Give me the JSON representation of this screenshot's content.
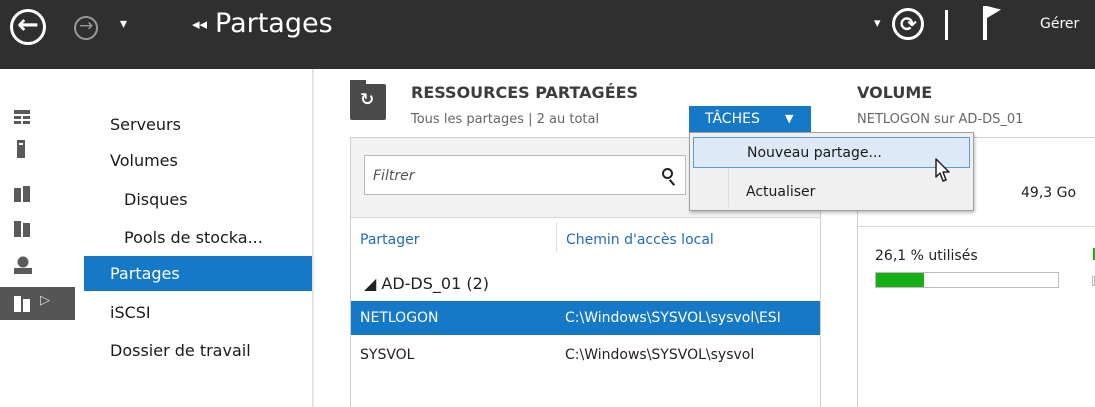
{
  "topbar": {
    "title": "Partages",
    "manage_label": "Gérer",
    "back_arrow": "←",
    "forward_arrow": "→",
    "nav_dropdown": "▾",
    "breadcrumb_chevron": "◂◂",
    "refresh_dropdown": "▾",
    "refresh_glyph": "⟳"
  },
  "icon_rail": {
    "items": [
      "dashboard-icon",
      "local-server-icon",
      "all-servers-icon",
      "file-services-icon",
      "users-icon",
      "file-storage-icon"
    ],
    "expand_glyph": "▷"
  },
  "nav": {
    "items": [
      {
        "label": "Serveurs",
        "level": 1,
        "active": false
      },
      {
        "label": "Volumes",
        "level": 1,
        "active": false
      },
      {
        "label": "Disques",
        "level": 2,
        "active": false
      },
      {
        "label": "Pools de stocka...",
        "level": 2,
        "active": false
      },
      {
        "label": "Partages",
        "level": 1,
        "active": true
      },
      {
        "label": "iSCSI",
        "level": 1,
        "active": false
      },
      {
        "label": "Dossier de travail",
        "level": 1,
        "active": false
      }
    ]
  },
  "shares": {
    "icon_glyph": "↻",
    "title": "RESSOURCES PARTAGÉES",
    "subtitle": "Tous les partages | 2 au total",
    "tasks_label": "TÂCHES",
    "tasks_caret": "▼",
    "filter_placeholder": "Filtrer",
    "columns": [
      "Partager",
      "Chemin d'accès local"
    ],
    "group_label": "◢  AD-DS_01 (2)",
    "rows": [
      {
        "name": "NETLOGON",
        "path": "C:\\Windows\\SYSVOL\\sysvol\\ESI",
        "selected": true
      },
      {
        "name": "SYSVOL",
        "path": "C:\\Windows\\SYSVOL\\sysvol",
        "selected": false
      }
    ]
  },
  "volume": {
    "title": "VOLUME",
    "subtitle": "NETLOGON sur AD-DS_01",
    "capacity": "49,3 Go",
    "used_label": "26,1 % utilisés",
    "used_fraction": 0.261
  },
  "tasks_menu": {
    "items": [
      {
        "label": "Nouveau partage...",
        "hover": true
      },
      {
        "label": "Actualiser",
        "hover": false
      }
    ]
  },
  "colors": {
    "topbar_bg": "#2f2f2f",
    "accent": "#1679c8",
    "usage_green": "#16b016"
  }
}
